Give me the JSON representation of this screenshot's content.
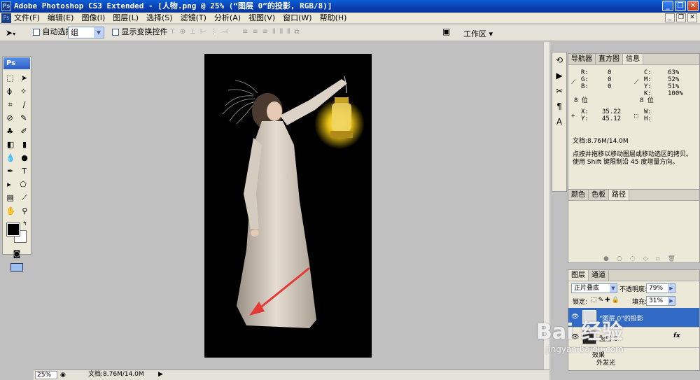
{
  "window": {
    "title": "Adobe Photoshop CS3 Extended - [人物.png @ 25% (“图层 0”的投影, RGB/8)]",
    "app_badge": "Ps",
    "controls": {
      "minimize": "_",
      "restore": "❐",
      "close": "✕"
    }
  },
  "menu": {
    "items": [
      "文件(F)",
      "编辑(E)",
      "图像(I)",
      "图层(L)",
      "选择(S)",
      "滤镜(T)",
      "分析(A)",
      "视图(V)",
      "窗口(W)",
      "帮助(H)"
    ]
  },
  "options": {
    "auto_select_label": "自动选择:",
    "auto_select_value": "组",
    "show_transform_label": "显示变换控件",
    "workspace_label": "工作区 ▾"
  },
  "toolbox": {
    "badge": "Ps"
  },
  "canvas": {
    "zoom": "25%",
    "doc_info": "文档:8.76M/14.0M"
  },
  "panels": {
    "info": {
      "tabs": [
        "导航器",
        "直方图",
        "信息"
      ],
      "active_tab": "信息",
      "r_label": "R:",
      "r": "0",
      "g_label": "G:",
      "g": "0",
      "b_label": "B:",
      "b": "0",
      "c_label": "C:",
      "c": "63%",
      "m_label": "M:",
      "m": "52%",
      "y_label": "Y:",
      "y": "51%",
      "k_label": "K:",
      "k": "100%",
      "bits_left": "8 位",
      "bits_right": "8 位",
      "x_label": "X:",
      "x": "35.22",
      "y2_label": "Y:",
      "y2": "45.12",
      "w_label": "W:",
      "h_label": "H:",
      "doc_info": "文档:8.76M/14.0M",
      "hint": "点按并拖移以移动图层或移动选区的拷贝。使用 Shift 键限制沿 45 度增量方向。"
    },
    "paths": {
      "tabs": [
        "颜色",
        "色板",
        "路径"
      ],
      "active_tab": "路径"
    },
    "layers": {
      "tabs": [
        "图层",
        "通道"
      ],
      "active_tab": "图层",
      "blend_mode": "正片叠底",
      "opacity_label": "不透明度:",
      "opacity": "79%",
      "lock_label": "锁定:",
      "fill_label": "填充:",
      "fill": "31%",
      "rows": [
        {
          "name": "“图层 0”的投影",
          "selected": true
        },
        {
          "name": "图层 0",
          "selected": false
        }
      ],
      "effects_label": "效果",
      "effect_item": "外发光"
    }
  },
  "watermark": {
    "brand": "Bai 经验",
    "url": "jingyan.baidu.com"
  },
  "colors": {
    "titlebar": "#0a3fb0",
    "accent": "#316ac5",
    "lantern_glow": "#e8c012",
    "arrow": "#e53935"
  }
}
